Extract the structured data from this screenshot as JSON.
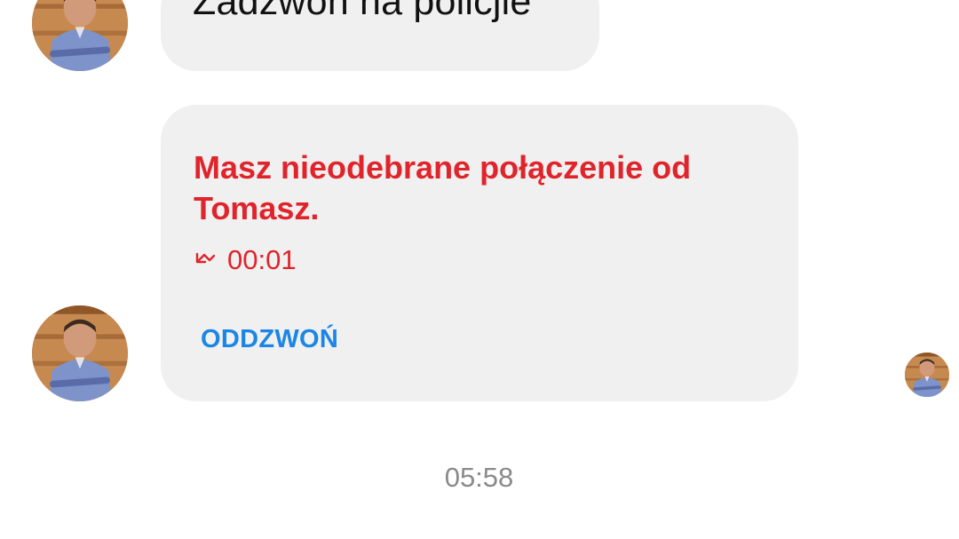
{
  "conversation": {
    "messages": [
      {
        "type": "text",
        "text": "Zadzwoń na policjie"
      },
      {
        "type": "missed_call",
        "title": "Masz nieodebrane połączenie od Tomasz.",
        "icon": "missed-call-icon",
        "duration": "00:01",
        "action_label": "ODDZWOŃ"
      }
    ],
    "timestamp": "05:58"
  },
  "colors": {
    "bubble": "#f0f0f0",
    "missed_call": "#e0242b",
    "action": "#1b86e5",
    "timestamp": "#8a8a8a"
  }
}
